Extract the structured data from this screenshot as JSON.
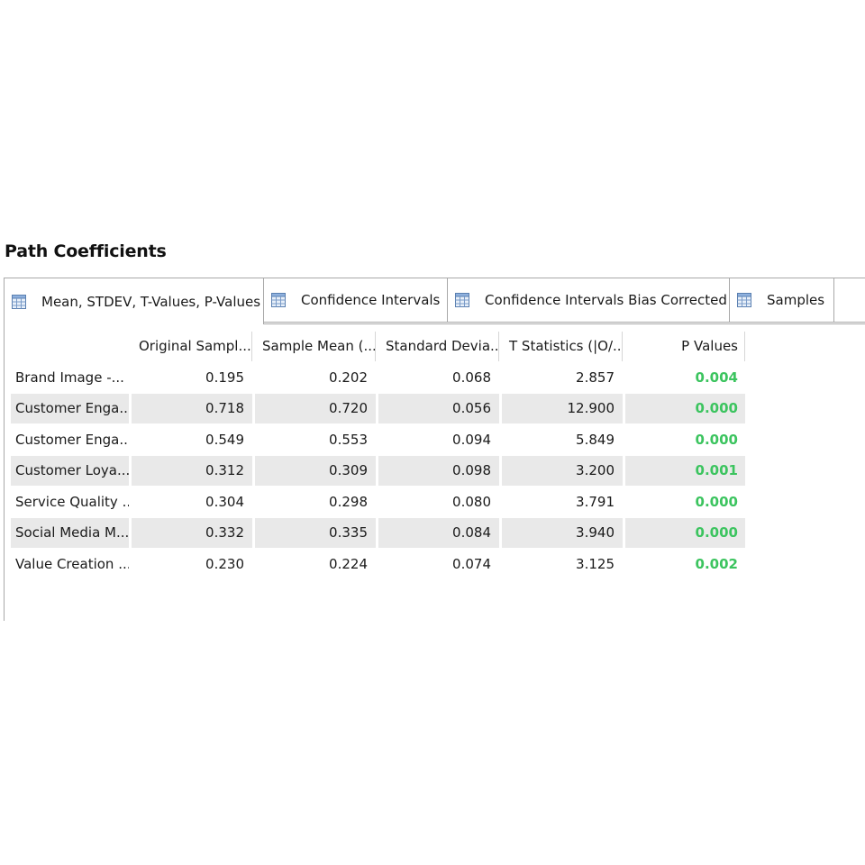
{
  "panel": {
    "title": "Path Coefficients"
  },
  "tabs": [
    {
      "label": "Mean, STDEV, T-Values, P-Values",
      "icon": "table-icon",
      "active": true
    },
    {
      "label": "Confidence Intervals",
      "icon": "table-icon",
      "active": false
    },
    {
      "label": "Confidence Intervals Bias Corrected",
      "icon": "table-icon",
      "active": false
    },
    {
      "label": "Samples",
      "icon": "table-icon",
      "active": false
    }
  ],
  "table": {
    "columns": [
      "Original Sampl...",
      "Sample Mean (...",
      "Standard Devia...",
      "T Statistics (|O/...",
      "P Values"
    ],
    "rows": [
      {
        "label": "Brand Image -...",
        "values": [
          "0.195",
          "0.202",
          "0.068",
          "2.857",
          "0.004"
        ]
      },
      {
        "label": "Customer Enga...",
        "values": [
          "0.718",
          "0.720",
          "0.056",
          "12.900",
          "0.000"
        ]
      },
      {
        "label": "Customer Enga...",
        "values": [
          "0.549",
          "0.553",
          "0.094",
          "5.849",
          "0.000"
        ]
      },
      {
        "label": "Customer Loya...",
        "values": [
          "0.312",
          "0.309",
          "0.098",
          "3.200",
          "0.001"
        ]
      },
      {
        "label": "Service Quality ...",
        "values": [
          "0.304",
          "0.298",
          "0.080",
          "3.791",
          "0.000"
        ]
      },
      {
        "label": "Social Media M...",
        "values": [
          "0.332",
          "0.335",
          "0.084",
          "3.940",
          "0.000"
        ]
      },
      {
        "label": "Value Creation ...",
        "values": [
          "0.230",
          "0.224",
          "0.074",
          "3.125",
          "0.002"
        ]
      }
    ]
  },
  "colors": {
    "significant_pvalue": "#3cc45f",
    "shaded_row": "#e9e9e9",
    "border": "#a8a8a8"
  }
}
